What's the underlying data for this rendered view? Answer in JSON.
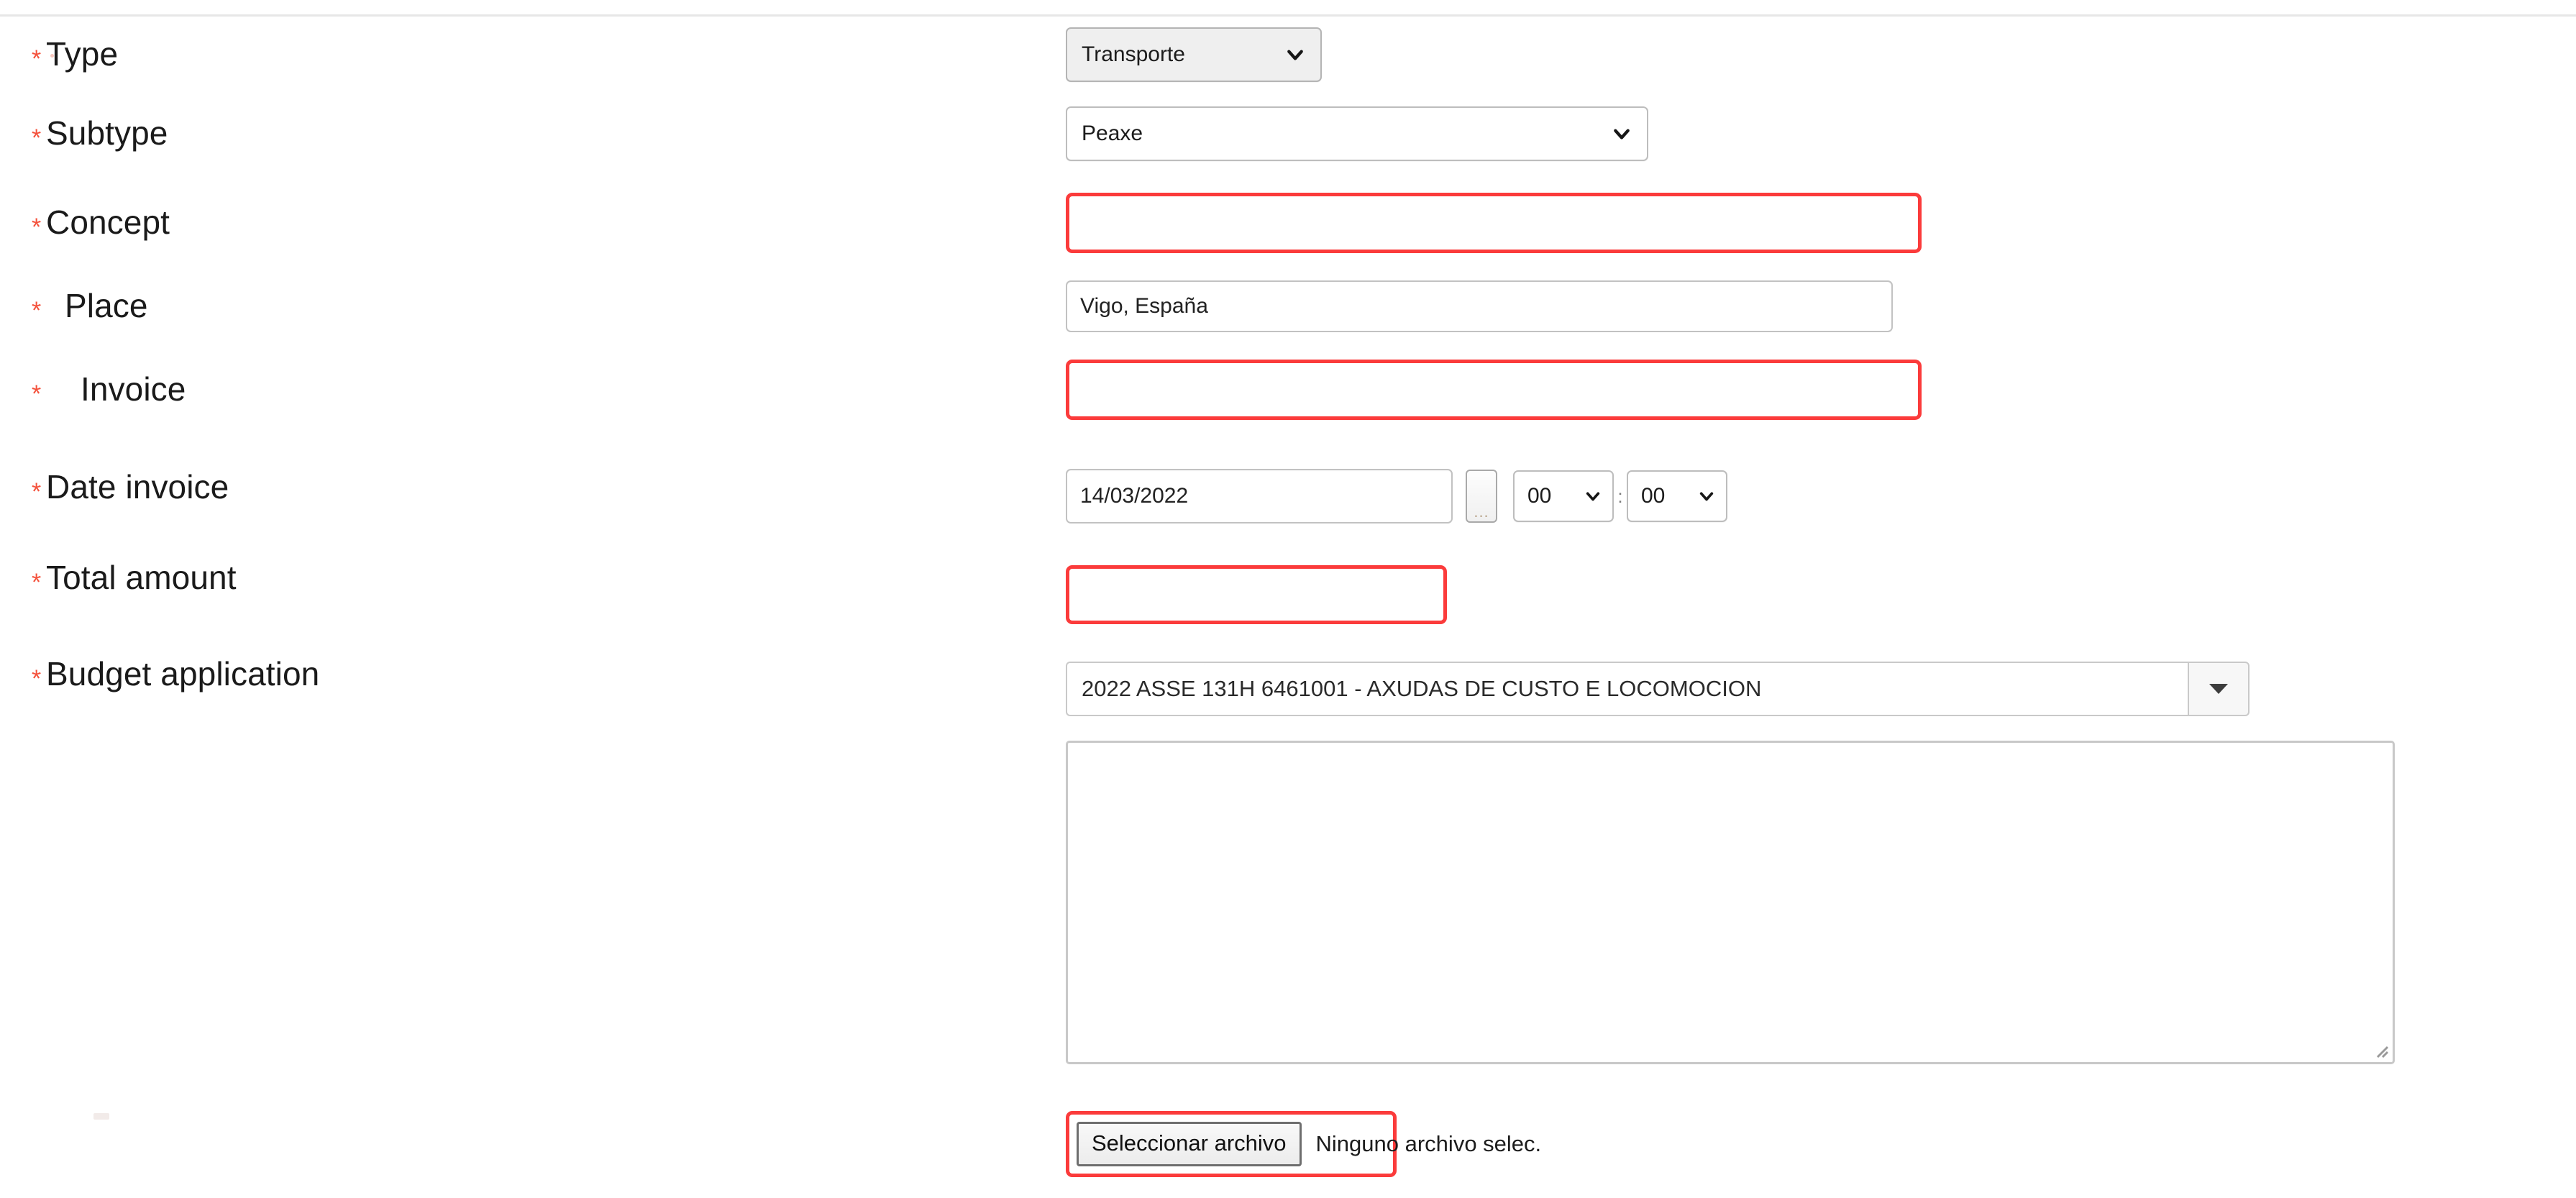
{
  "form": {
    "rows": [
      {
        "label": "Type",
        "required": true,
        "required_marker": "*",
        "control": "select",
        "value": "Transporte"
      },
      {
        "label": "Subtype",
        "required": true,
        "required_marker": "*",
        "control": "select",
        "value": "Peaxe"
      },
      {
        "label": "Concept",
        "required": true,
        "required_marker": "*",
        "control": "text",
        "value": ""
      },
      {
        "label": "Place",
        "required": true,
        "required_marker": "*",
        "control": "text",
        "value": "Vigo, España"
      },
      {
        "label": "Invoice",
        "required": true,
        "required_marker": "*",
        "control": "text",
        "value": ""
      },
      {
        "label": "Date invoice",
        "required": true,
        "required_marker": "*",
        "control": "date",
        "value": "14/03/2022",
        "hour": "00",
        "minute": "00",
        "time_separator": ":",
        "calendar_button_glyph": "..."
      },
      {
        "label": "Total amount",
        "required": true,
        "required_marker": "*",
        "control": "text",
        "value": ""
      },
      {
        "label": "Budget application",
        "required": true,
        "required_marker": "*",
        "control": "combo",
        "value": "2022 ASSE 131H 6461001 - AXUDAS DE CUSTO E LOCOMOCION"
      }
    ],
    "notes": {
      "value": "",
      "placeholder": ""
    },
    "file_upload": {
      "button_label": "Seleccionar archivo",
      "status_text": "Ninguno archivo selec."
    }
  },
  "colors": {
    "required_asterisk": "#f4513b",
    "invalid_border": "#fb3b3b",
    "field_border": "#c2c2c2",
    "label_text": "#1a1a1a",
    "disabled_select_bg": "#efefef"
  }
}
